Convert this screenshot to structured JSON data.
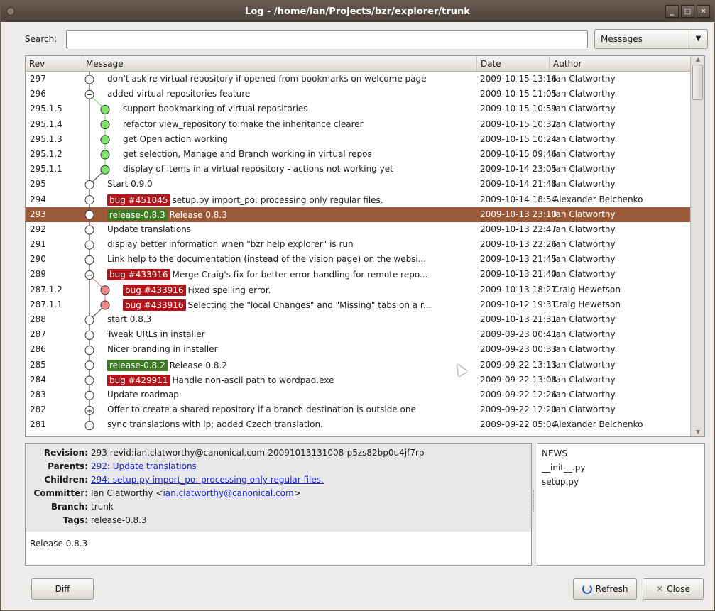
{
  "window": {
    "title": "Log - /home/ian/Projects/bzr/explorer/trunk",
    "buttons": [
      "_",
      "□",
      "✕"
    ]
  },
  "search": {
    "label_pre": "",
    "label_u": "S",
    "label_post": "earch:",
    "value": "",
    "mode": "Messages"
  },
  "columns": {
    "rev": "Rev",
    "message": "Message",
    "date": "Date",
    "author": "Author"
  },
  "rows": [
    {
      "rev": "297",
      "tags": [],
      "msg": "don't ask re virtual repository if opened from bookmarks on welcome page",
      "date": "2009-10-15 13:16",
      "author": "Ian Clatworthy"
    },
    {
      "rev": "296",
      "tags": [],
      "msg": "added virtual repositories feature",
      "date": "2009-10-15 11:05",
      "author": "Ian Clatworthy"
    },
    {
      "rev": "295.1.5",
      "tags": [],
      "msg": "support bookmarking of virtual repositories",
      "date": "2009-10-15 10:59",
      "author": "Ian Clatworthy"
    },
    {
      "rev": "295.1.4",
      "tags": [],
      "msg": "refactor view_repository to make the inheritance clearer",
      "date": "2009-10-15 10:32",
      "author": "Ian Clatworthy"
    },
    {
      "rev": "295.1.3",
      "tags": [],
      "msg": "get Open action working",
      "date": "2009-10-15 10:24",
      "author": "Ian Clatworthy"
    },
    {
      "rev": "295.1.2",
      "tags": [],
      "msg": "get selection, Manage and Branch working in virtual repos",
      "date": "2009-10-15 09:46",
      "author": "Ian Clatworthy"
    },
    {
      "rev": "295.1.1",
      "tags": [],
      "msg": "display of items in a virtual repository - actions not working yet",
      "date": "2009-10-14 23:05",
      "author": "Ian Clatworthy"
    },
    {
      "rev": "295",
      "tags": [],
      "msg": "Start 0.9.0",
      "date": "2009-10-14 21:48",
      "author": "Ian Clatworthy"
    },
    {
      "rev": "294",
      "tags": [
        {
          "kind": "bug",
          "text": "bug #451045"
        }
      ],
      "msg": "setup.py import_po: processing only regular files.",
      "date": "2009-10-14 18:54",
      "author": "Alexander Belchenko"
    },
    {
      "rev": "293",
      "tags": [
        {
          "kind": "rel",
          "text": "release-0.8.3"
        }
      ],
      "msg": "Release 0.8.3",
      "date": "2009-10-13 23:10",
      "author": "Ian Clatworthy"
    },
    {
      "rev": "292",
      "tags": [],
      "msg": "Update translations",
      "date": "2009-10-13 22:47",
      "author": "Ian Clatworthy"
    },
    {
      "rev": "291",
      "tags": [],
      "msg": "display better information when \"bzr help explorer\" is run",
      "date": "2009-10-13 22:26",
      "author": "Ian Clatworthy"
    },
    {
      "rev": "290",
      "tags": [],
      "msg": "Link help to the documentation (instead of the vision page) on the websi...",
      "date": "2009-10-13 21:45",
      "author": "Ian Clatworthy"
    },
    {
      "rev": "289",
      "tags": [
        {
          "kind": "bug",
          "text": "bug #433916"
        }
      ],
      "msg": "Merge Craig's fix for better error handling for remote repo...",
      "date": "2009-10-13 21:40",
      "author": "Ian Clatworthy"
    },
    {
      "rev": "287.1.2",
      "tags": [
        {
          "kind": "bug",
          "text": "bug #433916"
        }
      ],
      "msg": "Fixed spelling error.",
      "date": "2009-10-13 18:27",
      "author": "Craig Hewetson"
    },
    {
      "rev": "287.1.1",
      "tags": [
        {
          "kind": "bug",
          "text": "bug #433916"
        }
      ],
      "msg": "Selecting the \"local Changes\" and \"Missing\" tabs on a r...",
      "date": "2009-10-12 19:31",
      "author": "Craig Hewetson"
    },
    {
      "rev": "288",
      "tags": [],
      "msg": "start 0.8.3",
      "date": "2009-10-13 21:31",
      "author": "Ian Clatworthy"
    },
    {
      "rev": "287",
      "tags": [],
      "msg": "Tweak URLs in installer",
      "date": "2009-09-23 00:41",
      "author": "Ian Clatworthy"
    },
    {
      "rev": "286",
      "tags": [],
      "msg": "Nicer branding in installer",
      "date": "2009-09-23 00:33",
      "author": "Ian Clatworthy"
    },
    {
      "rev": "285",
      "tags": [
        {
          "kind": "rel",
          "text": "release-0.8.2"
        }
      ],
      "msg": "Release 0.8.2",
      "date": "2009-09-22 13:13",
      "author": "Ian Clatworthy"
    },
    {
      "rev": "284",
      "tags": [
        {
          "kind": "bug",
          "text": "bug #429911"
        }
      ],
      "msg": "Handle non-ascii path to wordpad.exe",
      "date": "2009-09-22 13:08",
      "author": "Ian Clatworthy"
    },
    {
      "rev": "283",
      "tags": [],
      "msg": "Update roadmap",
      "date": "2009-09-22 12:26",
      "author": "Ian Clatworthy"
    },
    {
      "rev": "282",
      "tags": [],
      "msg": "Offer to create a shared repository if a branch destination is outside one",
      "date": "2009-09-22 12:20",
      "author": "Ian Clatworthy"
    },
    {
      "rev": "281",
      "tags": [],
      "msg": "sync translations with lp; added Czech translation.",
      "date": "2009-09-22 05:04",
      "author": "Alexander Belchenko"
    }
  ],
  "selected_rev": "293",
  "details": {
    "revision_label": "Revision:",
    "revision": "293 revid:ian.clatworthy@canonical.com-20091013131008-p5zs82bp0u4jf7rp",
    "parents_label": "Parents:",
    "parents": "292: Update translations",
    "children_label": "Children:",
    "children": "294: setup.py import_po: processing only regular files.",
    "committer_label": "Committer:",
    "committer_pre": "Ian Clatworthy <",
    "committer_email": "ian.clatworthy@canonical.com",
    "committer_post": ">",
    "branch_label": "Branch:",
    "branch": "trunk",
    "tags_label": "Tags:",
    "tags": "release-0.8.3",
    "message": "Release 0.8.3"
  },
  "files": [
    "NEWS",
    "__init__.py",
    "setup.py"
  ],
  "buttons": {
    "diff": "Diff",
    "refresh_u": "R",
    "refresh_rest": "efresh",
    "close_u": "C",
    "close_rest": "lose"
  },
  "colors": {
    "selection": "#9a5a39",
    "bug_tag": "#b3161a",
    "release_tag": "#3d7a24",
    "branch_green": "#7de36a",
    "branch_red": "#f08888"
  }
}
